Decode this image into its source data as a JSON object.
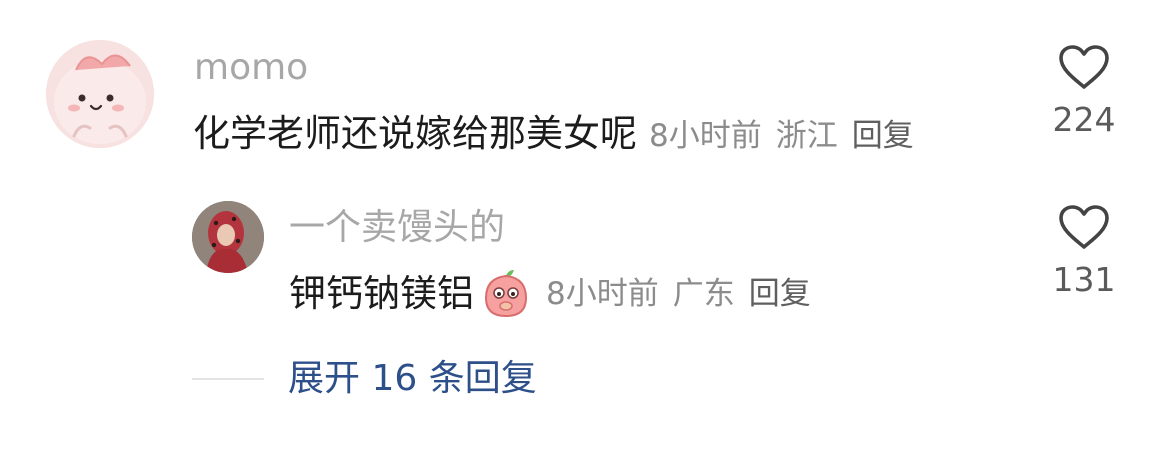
{
  "comment": {
    "username": "momo",
    "text": "化学老师还说嫁给那美女呢",
    "time": "8小时前",
    "location": "浙江",
    "reply_label": "回复",
    "likes": "224"
  },
  "reply": {
    "username": "一个卖馒头的",
    "text": "钾钙钠镁铝",
    "emoji_icon": "peach-shy-face-icon",
    "time": "8小时前",
    "location": "广东",
    "reply_label": "回复",
    "likes": "131"
  },
  "thread": {
    "expand_label": "展开 16 条回复"
  },
  "colors": {
    "username": "#a7a7a7",
    "body_text": "#1c1c1c",
    "meta_text": "#8c8c8c",
    "link_blue": "#2d4f8a"
  }
}
